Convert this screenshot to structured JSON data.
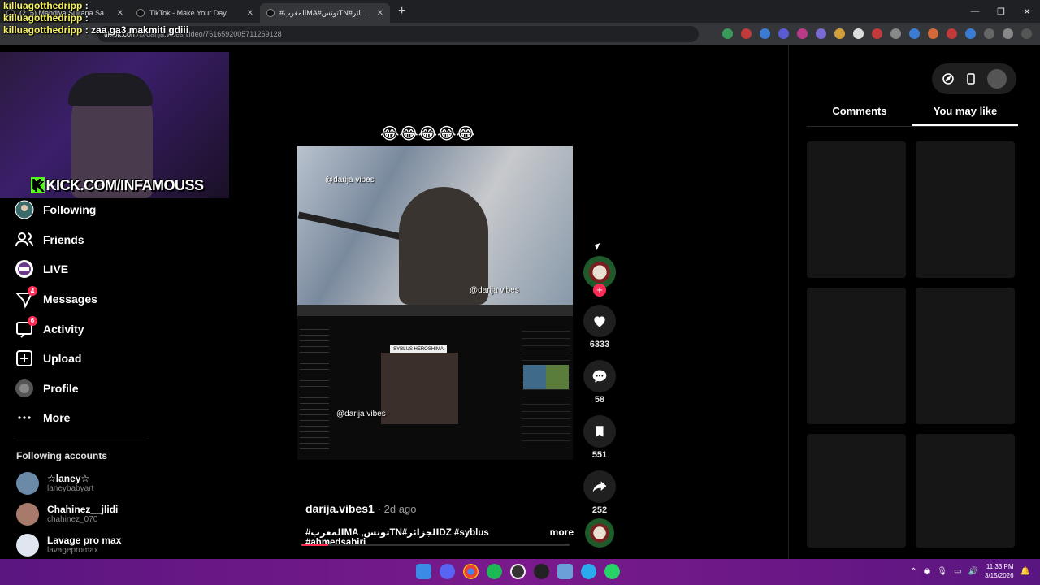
{
  "browser": {
    "tabs": [
      {
        "title": "(215) Mehdiya Sultana Saha Y..."
      },
      {
        "title": "TikTok - Make Your Day"
      },
      {
        "title": "#المغربMA#تونسTN#الجزائرTok"
      }
    ],
    "url_domain": "tiktok.com",
    "url_path": "/@darija.vibes/video/7616592005711269128"
  },
  "stream_overlay": {
    "chat": [
      {
        "user": "killuagotthedripp",
        "message": ":"
      },
      {
        "user": "killuagotthedripp",
        "message": ":"
      },
      {
        "user": "killuagotthedripp",
        "message": ": zaa ga3 makmiti gdiii"
      }
    ],
    "kick_banner": "KICK.COM/INFAMOUSS",
    "kick_mark": "K"
  },
  "sidebar": {
    "items": [
      {
        "label": "Following",
        "icon": "following-avatar-icon",
        "badge": ""
      },
      {
        "label": "Friends",
        "icon": "friends-icon",
        "badge": ""
      },
      {
        "label": "LIVE",
        "icon": "live-icon",
        "badge": ""
      },
      {
        "label": "Messages",
        "icon": "messages-icon",
        "badge": "4"
      },
      {
        "label": "Activity",
        "icon": "activity-icon",
        "badge": "6"
      },
      {
        "label": "Upload",
        "icon": "upload-icon",
        "badge": ""
      },
      {
        "label": "Profile",
        "icon": "profile-icon",
        "badge": ""
      },
      {
        "label": "More",
        "icon": "more-icon",
        "badge": ""
      }
    ],
    "following_title": "Following accounts",
    "accounts": [
      {
        "name": "☆laney☆",
        "handle": "laneybabyart",
        "color": "#6b8aa8"
      },
      {
        "name": "Chahinez__jlidi",
        "handle": "chahinez_070",
        "color": "#a87a6b"
      },
      {
        "name": "Lavage pro max",
        "handle": "lavagepromax",
        "color": "#dfe6ef"
      }
    ]
  },
  "video": {
    "top_caption": "😂😂😂😂😂",
    "watermark": "@darija vibes",
    "inner_tag": "SYBLUS HEROSHIMA 🔥",
    "author": "darija.vibes1",
    "age": "2d ago",
    "description": "#المغربMA ,تونسTN#الجزائرDZ #syblus #ahmedsabiri ...",
    "more_label": "more",
    "progress": 0.1
  },
  "actions": {
    "likes": "6333",
    "comments": "58",
    "saves": "551",
    "shares": "252"
  },
  "right_panel": {
    "tabs": [
      "Comments",
      "You may like"
    ],
    "active_tab": "You may like"
  },
  "system": {
    "time": "11:33 PM",
    "date": "3/15/2026",
    "accent": "#fe2c55",
    "taskbar_color": "#6b1886"
  }
}
